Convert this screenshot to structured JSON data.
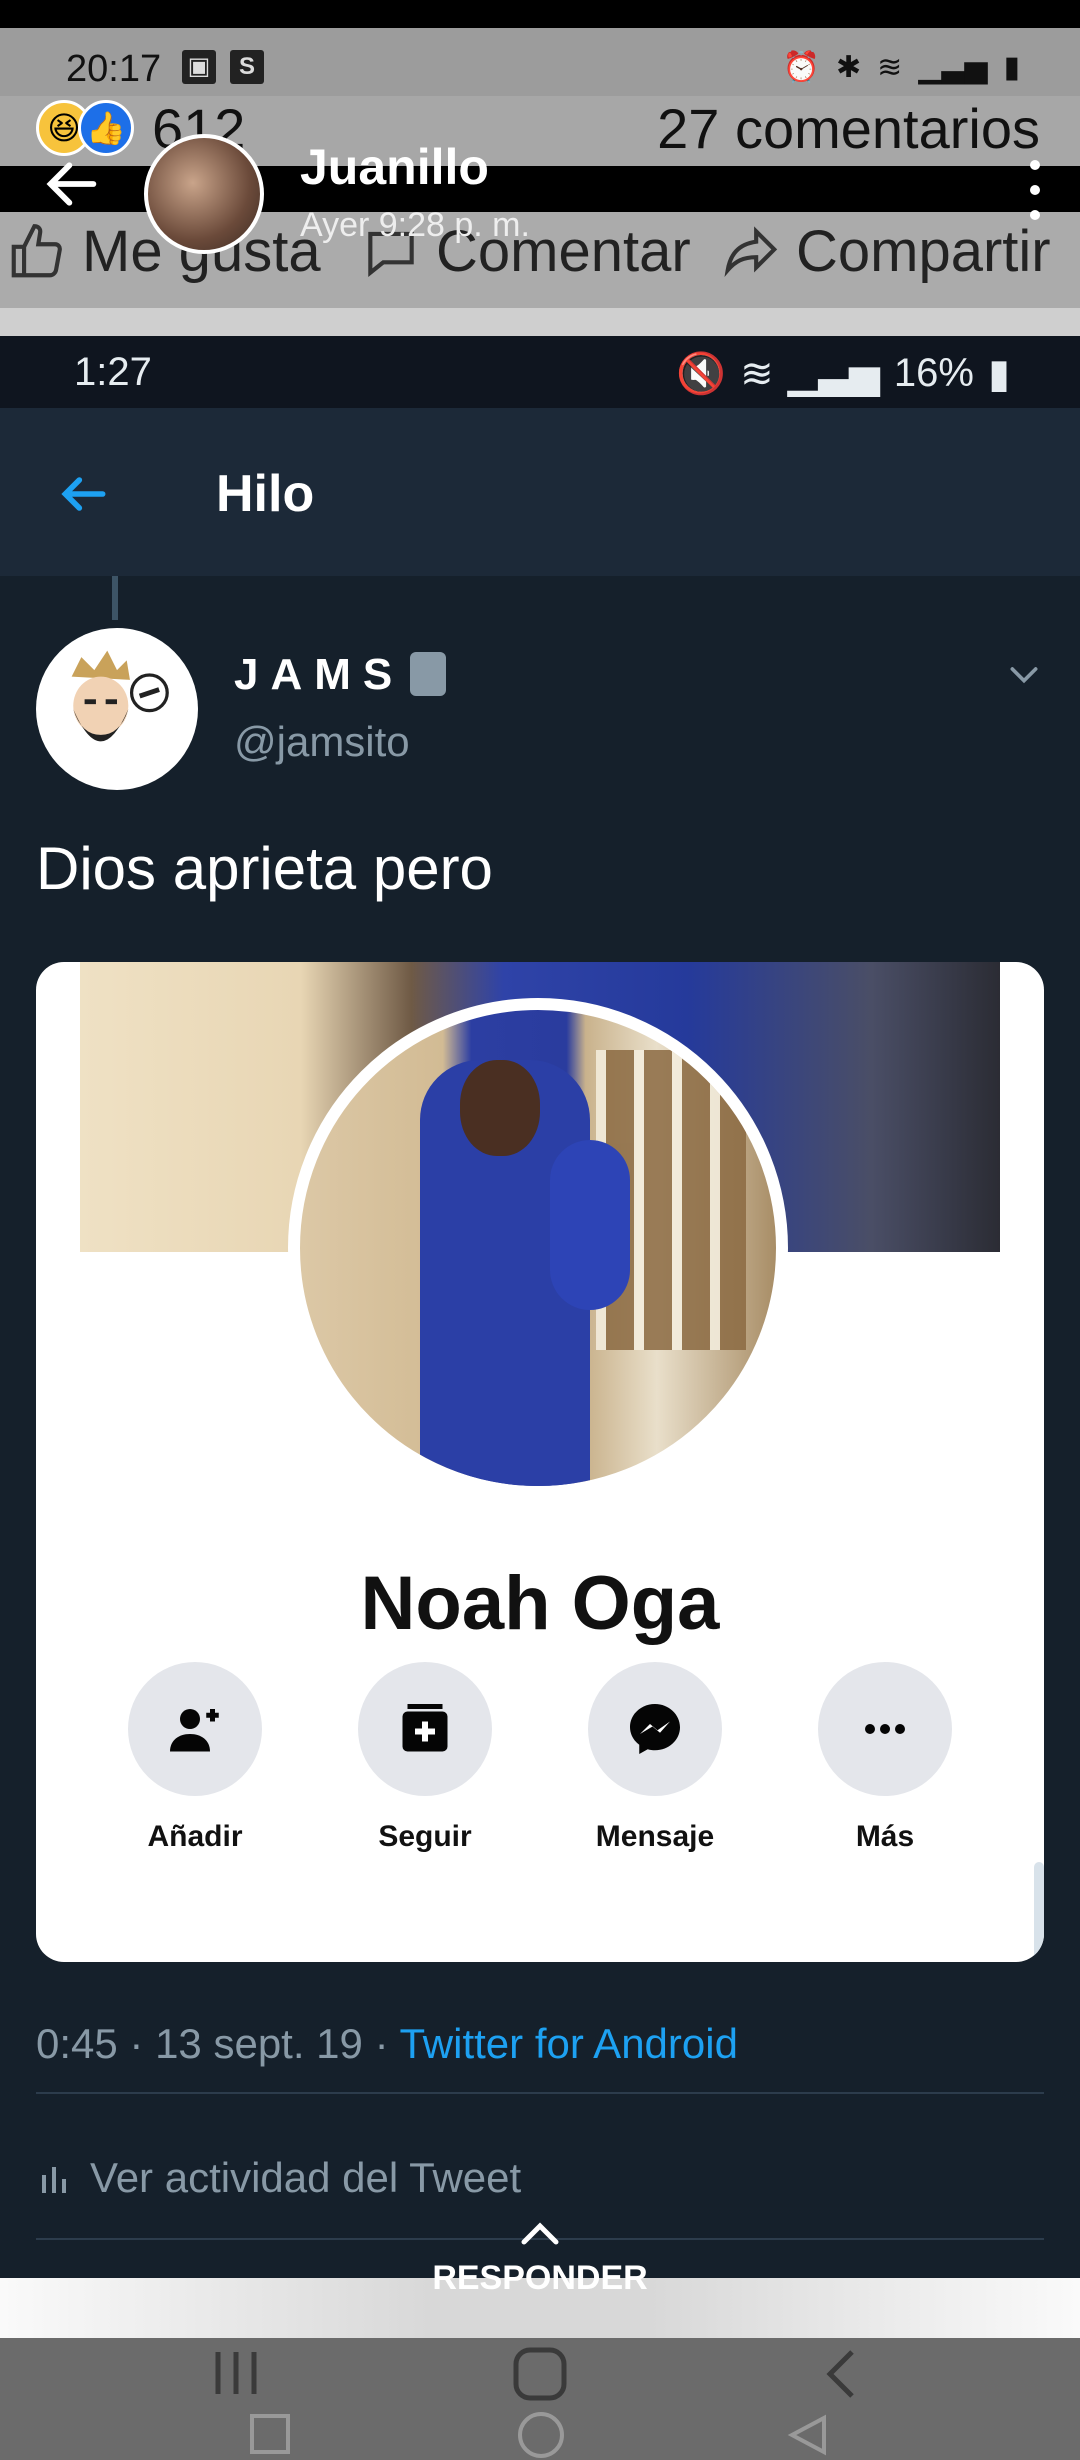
{
  "outer_status": {
    "time": "20:17",
    "icons": [
      "gallery-icon",
      "s-app-icon",
      "alarm-icon",
      "bluetooth-icon",
      "wifi-icon",
      "signal-icon",
      "battery-icon"
    ]
  },
  "reactions": {
    "count": "612",
    "comments": "27 comentarios"
  },
  "fb_post": {
    "author": "Juanillo",
    "time": "Ayer 9:28 p. m."
  },
  "fb_actions": {
    "like": "Me gusta",
    "comment": "Comentar",
    "share": "Compartir"
  },
  "tw_status": {
    "time": "1:27",
    "battery": "16%"
  },
  "tw_header": {
    "title": "Hilo"
  },
  "tweet": {
    "name": "JAMS",
    "handle": "@jamsito",
    "text": "Dios aprieta pero",
    "meta_time": "0:45 · 13 sept. 19 · ",
    "meta_app": "Twitter for Android",
    "activity": "Ver actividad del Tweet"
  },
  "profile_card": {
    "name": "Noah Oga",
    "buttons": [
      {
        "label": "Añadir",
        "icon": "add-friend-icon"
      },
      {
        "label": "Seguir",
        "icon": "follow-icon"
      },
      {
        "label": "Mensaje",
        "icon": "messenger-icon"
      },
      {
        "label": "Más",
        "icon": "more-icon"
      }
    ]
  },
  "reply": {
    "label": "RESPONDER"
  },
  "colors": {
    "twitter_bg": "#15202b",
    "twitter_header": "#1c2938",
    "twitter_blue": "#1da1f2",
    "fb_blue": "#1d6fe8"
  }
}
